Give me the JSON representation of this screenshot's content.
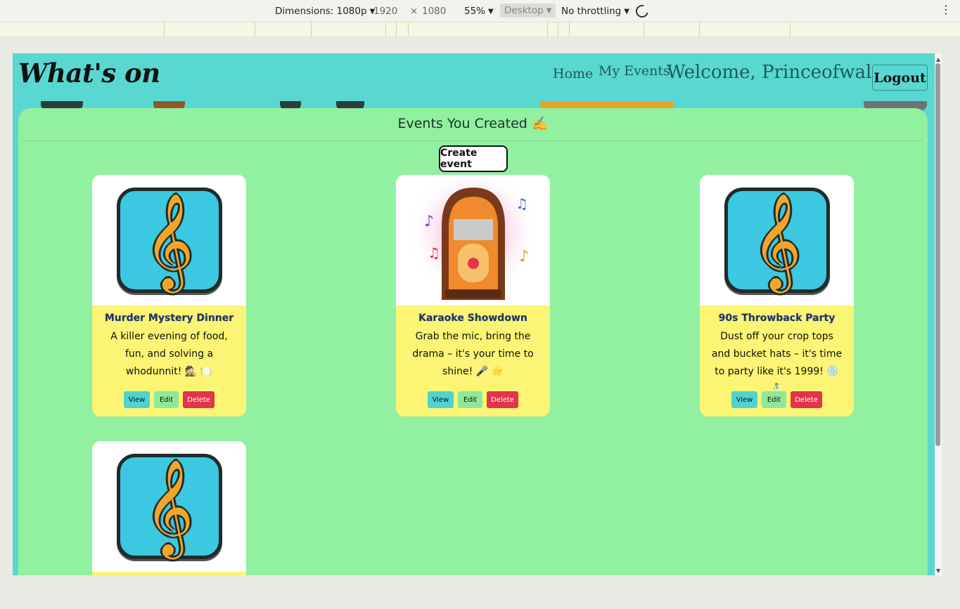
{
  "devtools": {
    "dimensions_label": "Dimensions: 1080p",
    "width": "1920",
    "times": "×",
    "height": "1080",
    "zoom": "55%",
    "device_mode": "Desktop",
    "throttling": "No throttling"
  },
  "nav": {
    "brand": "What's on",
    "home": "Home",
    "my_events": "My Events",
    "welcome": "Welcome, Princeofwales!",
    "logout": "Logout"
  },
  "panel": {
    "title": "Events You Created ✍️",
    "create_button": "Create event"
  },
  "events": [
    {
      "title": "Murder Mystery Dinner",
      "description": "A killer evening of food, fun, and solving a whodunnit! 🕵️ 🍽️",
      "image": "music-note-icon"
    },
    {
      "title": "Karaoke Showdown",
      "description": "Grab the mic, bring the drama – it's your time to shine! 🎤 🌟",
      "image": "jukebox-image"
    },
    {
      "title": "90s Throwback Party",
      "description": "Dust off your crop tops and bucket hats – it's time to party like it's 1999! 💿 🕺",
      "image": "music-note-icon"
    },
    {
      "title": "",
      "description": "",
      "image": "music-note-icon"
    }
  ],
  "buttons": {
    "view": "View",
    "edit": "Edit",
    "delete": "Delete"
  },
  "colors": {
    "header_bg": "#58d8d1",
    "panel_bg": "#92f0a1",
    "card_body": "#fbf474",
    "view_btn": "#4fd3d0",
    "edit_btn": "#8fe89a",
    "delete_btn": "#e2344a"
  }
}
